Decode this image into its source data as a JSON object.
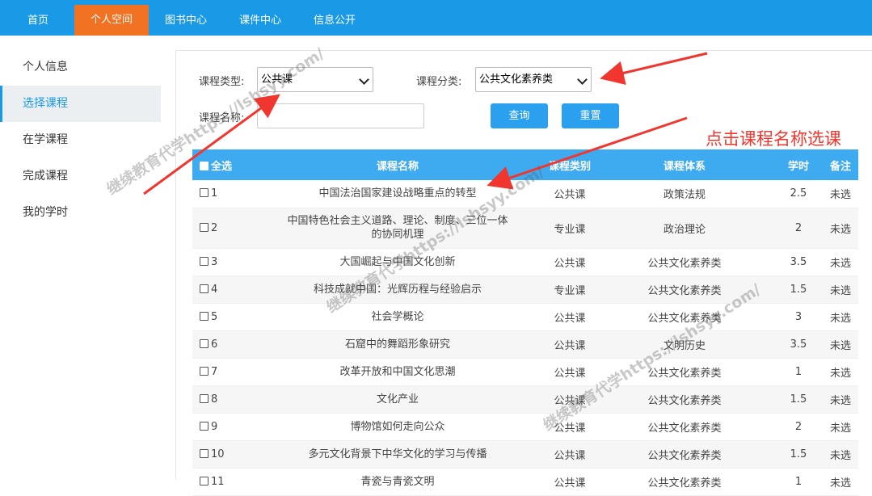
{
  "topnav": {
    "items": [
      {
        "label": "首页"
      },
      {
        "label": "个人空间"
      },
      {
        "label": "图书中心"
      },
      {
        "label": "课件中心"
      },
      {
        "label": "信息公开"
      }
    ],
    "active_color": "#f07222",
    "bar_color": "#1a9ae6"
  },
  "sidebar": {
    "items": [
      {
        "label": "个人信息"
      },
      {
        "label": "选择课程"
      },
      {
        "label": "在学课程"
      },
      {
        "label": "完成课程"
      },
      {
        "label": "我的学时"
      }
    ]
  },
  "filters": {
    "type_label": "课程类型:",
    "type_value": "公共课",
    "category_label": "课程分类:",
    "category_value": "公共文化素养类",
    "name_label": "课程名称:",
    "name_value": "",
    "query_button": "查询",
    "reset_button": "重置"
  },
  "table": {
    "headers": [
      "全选",
      "课程名称",
      "课程类别",
      "课程体系",
      "学时",
      "备注"
    ],
    "rows": [
      {
        "no": "1",
        "name": "中国法治国家建设战略重点的转型",
        "kind": "公共课",
        "system": "政策法规",
        "hours": "2.5",
        "note": "未选"
      },
      {
        "no": "2",
        "name": "中国特色社会主义道路、理论、制度、三位一体的协同机理",
        "kind": "专业课",
        "system": "政治理论",
        "hours": "2",
        "note": "未选"
      },
      {
        "no": "3",
        "name": "大国崛起与中国文化创新",
        "kind": "公共课",
        "system": "公共文化素养类",
        "hours": "3.5",
        "note": "未选"
      },
      {
        "no": "4",
        "name": "科技成就中国：光辉历程与经验启示",
        "kind": "专业课",
        "system": "公共文化素养类",
        "hours": "1.5",
        "note": "未选"
      },
      {
        "no": "5",
        "name": "社会学概论",
        "kind": "公共课",
        "system": "公共文化素养类",
        "hours": "3",
        "note": "未选"
      },
      {
        "no": "6",
        "name": "石窟中的舞蹈形象研究",
        "kind": "公共课",
        "system": "文明历史",
        "hours": "3.5",
        "note": "未选"
      },
      {
        "no": "7",
        "name": "改革开放和中国文化思潮",
        "kind": "公共课",
        "system": "公共文化素养类",
        "hours": "1",
        "note": "未选"
      },
      {
        "no": "8",
        "name": "文化产业",
        "kind": "公共课",
        "system": "公共文化素养类",
        "hours": "1.5",
        "note": "未选"
      },
      {
        "no": "9",
        "name": "博物馆如何走向公众",
        "kind": "公共课",
        "system": "公共文化素养类",
        "hours": "2",
        "note": "未选"
      },
      {
        "no": "10",
        "name": "多元文化背景下中华文化的学习与传播",
        "kind": "公共课",
        "system": "公共文化素养类",
        "hours": "1.5",
        "note": "未选"
      },
      {
        "no": "11",
        "name": "青瓷与青瓷文明",
        "kind": "公共课",
        "system": "公共文化素养类",
        "hours": "1",
        "note": "未选"
      }
    ]
  },
  "annotation": {
    "hint": "点击课程名称选课",
    "color": "#f0362e"
  },
  "watermark": {
    "text": "继续教育代学https://lshsyy.com/"
  }
}
